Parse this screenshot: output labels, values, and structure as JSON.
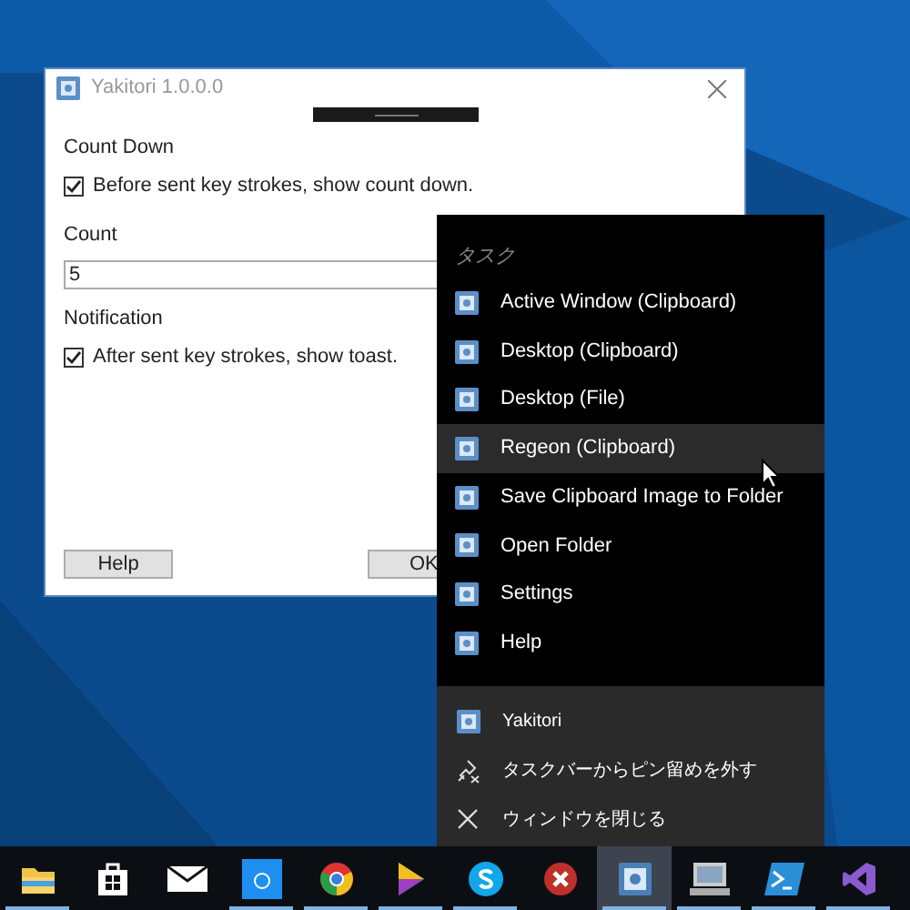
{
  "dialog": {
    "title": "Yakitori 1.0.0.0",
    "sections": [
      {
        "kind": "heading",
        "text": "Count Down"
      },
      {
        "kind": "checkbox",
        "text": "Before sent key strokes, show count down.",
        "checked": true
      },
      {
        "kind": "heading",
        "text": "Count"
      },
      {
        "kind": "field",
        "value": "5"
      },
      {
        "kind": "heading",
        "text": "Notification"
      },
      {
        "kind": "checkbox",
        "text": "After sent key strokes, show toast.",
        "checked": true
      }
    ],
    "buttons": [
      "Help",
      "OK"
    ]
  },
  "jump_list": {
    "header": "タスク",
    "tasks": [
      {
        "label": "Active Window (Clipboard)",
        "selected": false
      },
      {
        "label": "Desktop (Clipboard)",
        "selected": false
      },
      {
        "label": "Desktop (File)",
        "selected": false
      },
      {
        "label": "Regeon (Clipboard)",
        "selected": true
      },
      {
        "label": "Save Clipboard Image to Folder",
        "selected": false
      },
      {
        "label": "Open Folder",
        "selected": false
      },
      {
        "label": "Settings",
        "selected": false
      },
      {
        "label": "Help",
        "selected": false
      }
    ],
    "actions": [
      {
        "kind": "app",
        "label": "Yakitori"
      },
      {
        "kind": "unpin",
        "label": "タスクバーからピン留めを外す"
      },
      {
        "kind": "close",
        "label": "ウィンドウを閉じる"
      }
    ]
  },
  "taskbar": [
    {
      "kind": "folder",
      "running": true,
      "selected": false
    },
    {
      "kind": "store",
      "running": false,
      "selected": false
    },
    {
      "kind": "mail",
      "running": false,
      "selected": false
    },
    {
      "kind": "bluebox",
      "running": true,
      "selected": false
    },
    {
      "kind": "chrome",
      "running": true,
      "selected": false
    },
    {
      "kind": "triangle",
      "running": true,
      "selected": false
    },
    {
      "kind": "skype",
      "running": true,
      "selected": false
    },
    {
      "kind": "redx",
      "running": false,
      "selected": false
    },
    {
      "kind": "yakitori",
      "running": true,
      "selected": true
    },
    {
      "kind": "monitor",
      "running": true,
      "selected": false
    },
    {
      "kind": "shell",
      "running": true,
      "selected": false
    },
    {
      "kind": "vs",
      "running": true,
      "selected": false
    }
  ]
}
